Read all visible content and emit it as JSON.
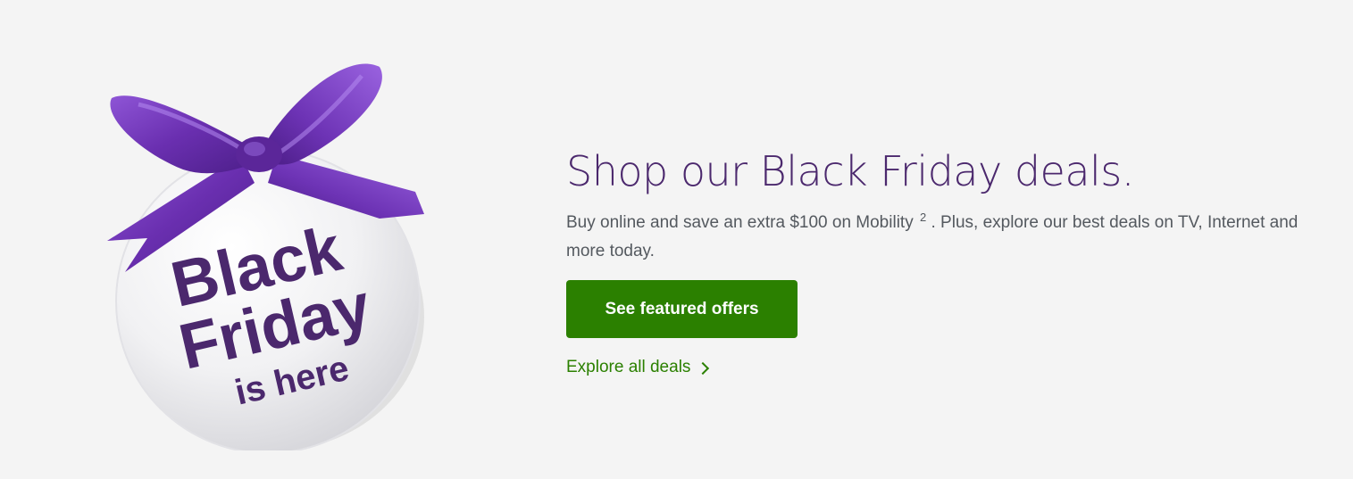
{
  "badge": {
    "line1": "Black",
    "line2": "Friday",
    "line3": "is here",
    "ribbon_color": "#7b3fbf",
    "text_color": "#4b286d"
  },
  "promo": {
    "headline": "Shop our Black Friday deals.",
    "body_before": "Buy online and save an extra $100 on Mobility",
    "footnote": "2",
    "body_after": ". Plus, explore our best deals on TV, Internet and more today.",
    "primary_cta": "See featured offers",
    "secondary_link": "Explore all deals",
    "secondary_link_icon": "chevron-right-icon"
  },
  "colors": {
    "background": "#f4f4f4",
    "brand_purple": "#4b286d",
    "cta_green": "#2b8000",
    "body_text": "#54595f"
  }
}
